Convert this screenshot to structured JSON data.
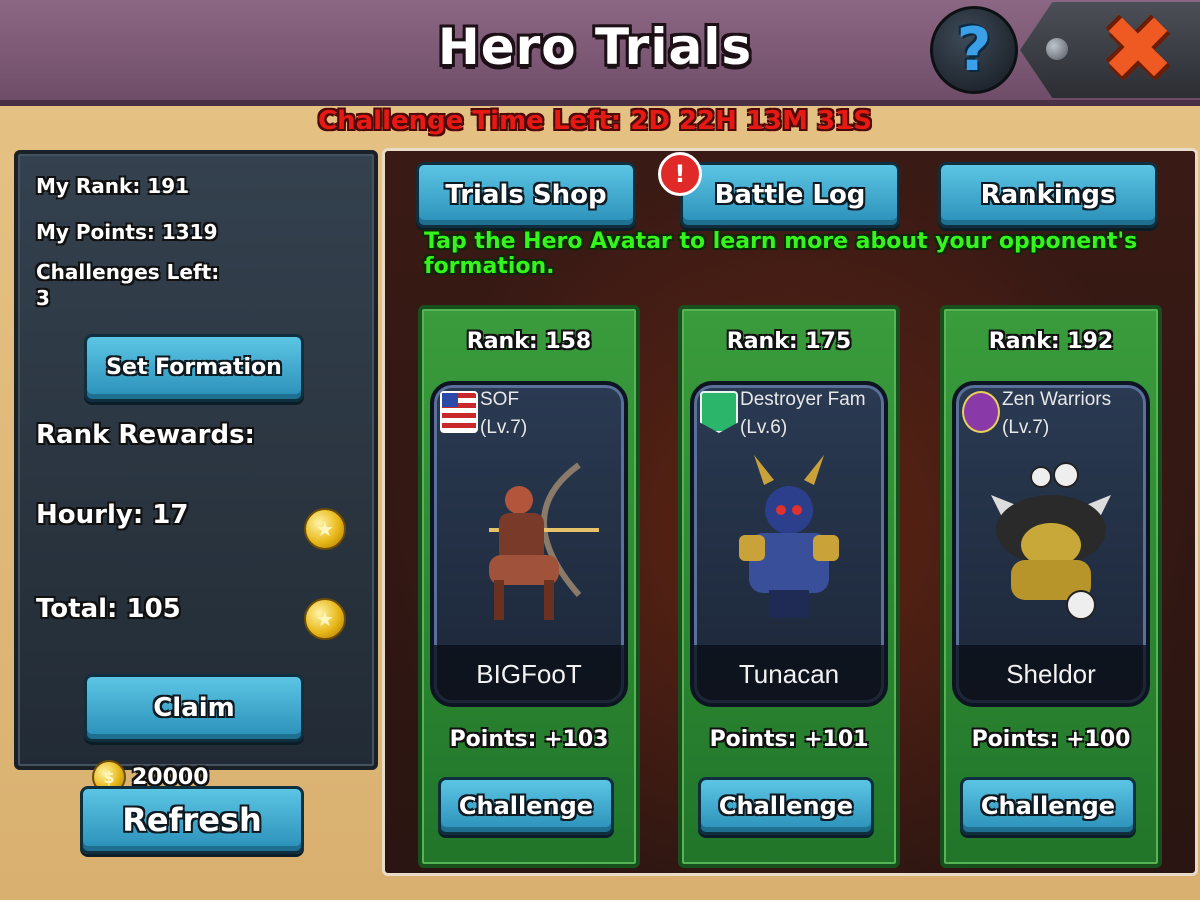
{
  "header": {
    "title": "Hero Trials",
    "help_label": "?",
    "close_label": "✖"
  },
  "timer_text": "Challenge Time Left: 2D 22H 13M 31S",
  "left_panel": {
    "my_rank": "My Rank: 191",
    "my_points": "My Points: 1319",
    "challenges_left_label": "Challenges Left:",
    "challenges_left_value": "3",
    "set_formation_label": "Set Formation",
    "rank_rewards_label": "Rank Rewards:",
    "hourly": "Hourly: 17",
    "total": "Total: 105",
    "claim_label": "Claim",
    "refresh_cost": "20000",
    "refresh_label": "Refresh"
  },
  "tabs": {
    "trials_shop": "Trials Shop",
    "battle_log": "Battle Log",
    "battle_log_alert": "!",
    "rankings": "Rankings"
  },
  "tip": "Tap the Hero Avatar to learn more about your opponent's formation.",
  "opponents": [
    {
      "rank": "Rank: 158",
      "guild": "SOF",
      "level": "(Lv.7)",
      "name": "BIGFooT",
      "points": "Points: +103",
      "challenge": "Challenge",
      "badge_color": "#3a63c8"
    },
    {
      "rank": "Rank: 175",
      "guild": "Destroyer Fam",
      "level": "(Lv.6)",
      "name": "Tunacan",
      "points": "Points: +101",
      "challenge": "Challenge",
      "badge_color": "#2bb56a"
    },
    {
      "rank": "Rank: 192",
      "guild": "Zen Warriors",
      "level": "(Lv.7)",
      "name": "Sheldor",
      "points": "Points: +100",
      "challenge": "Challenge",
      "badge_color": "#8a3aa8"
    }
  ],
  "icons": {
    "coin": "gold-coin-icon",
    "help": "question-icon",
    "close": "close-icon",
    "alert": "exclamation-icon"
  },
  "colors": {
    "timer": "#e51a14",
    "tip": "#35f51c",
    "button": "#3aa9d0",
    "card": "#2e8a34"
  }
}
